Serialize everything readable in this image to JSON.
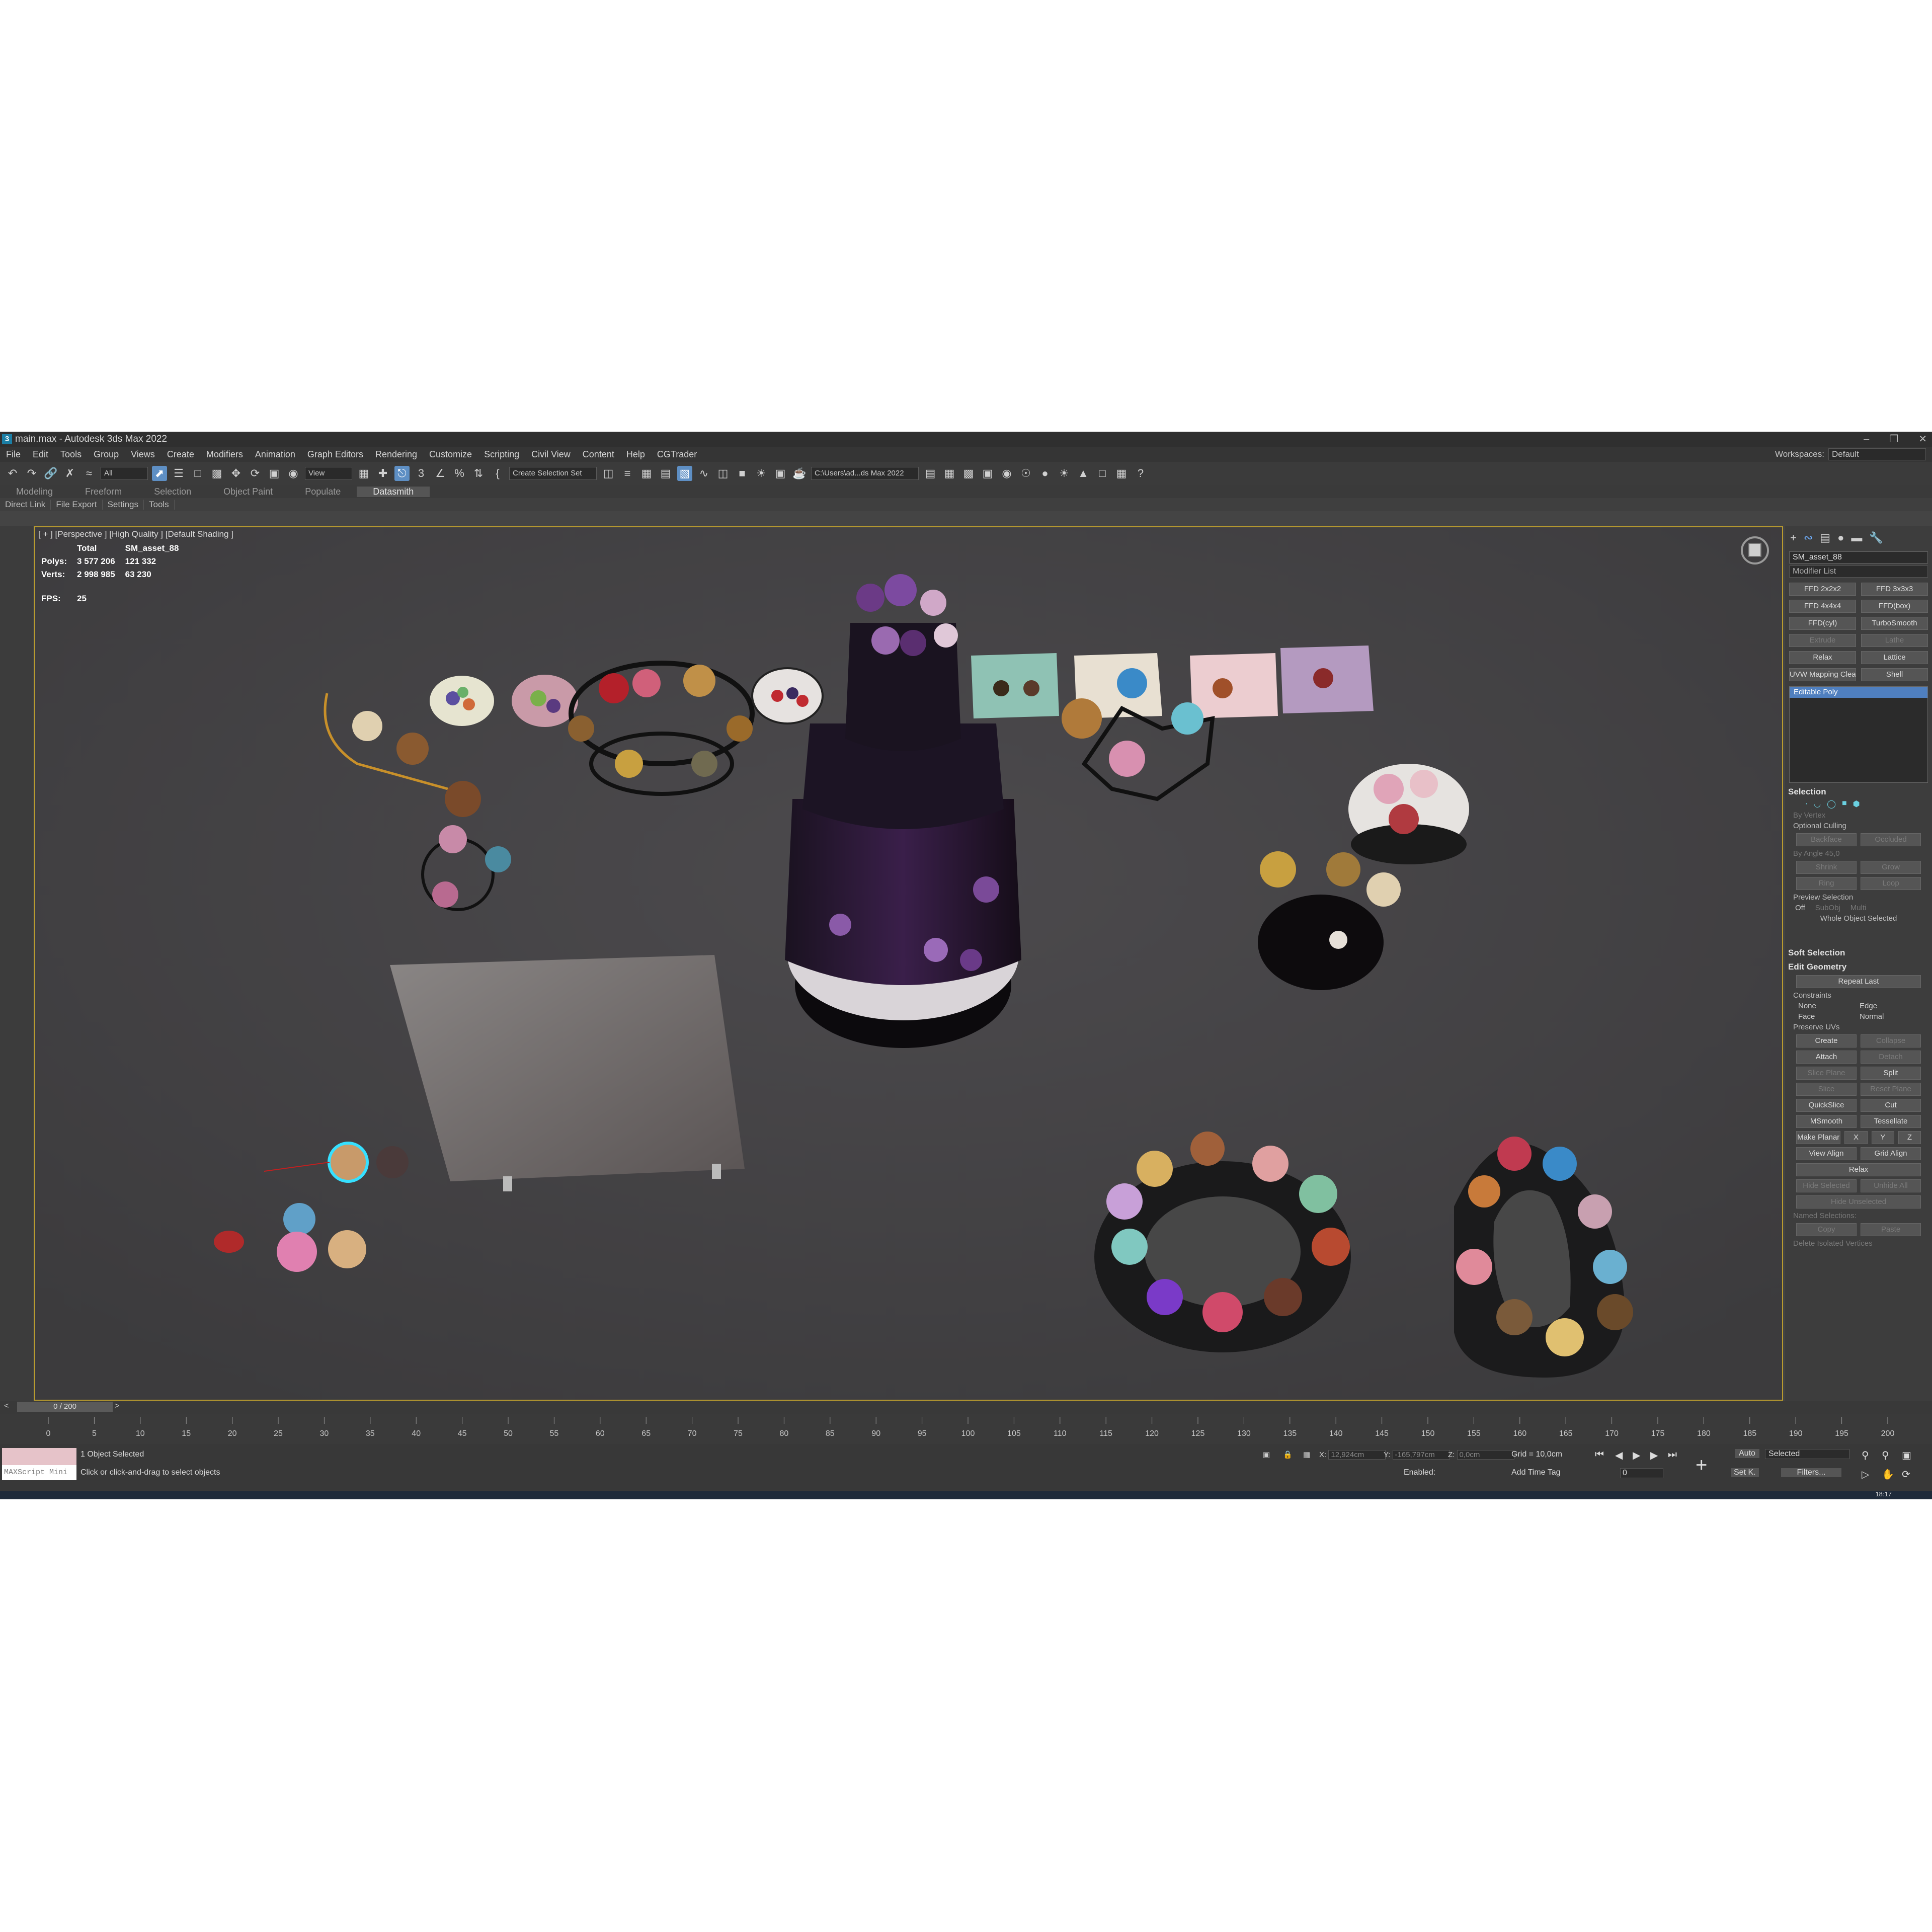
{
  "window": {
    "title": "main.max - Autodesk 3ds Max 2022",
    "app_icon": "3"
  },
  "menu": [
    "File",
    "Edit",
    "Tools",
    "Group",
    "Views",
    "Create",
    "Modifiers",
    "Animation",
    "Graph Editors",
    "Rendering",
    "Customize",
    "Scripting",
    "Civil View",
    "Content",
    "Help",
    "CGTrader"
  ],
  "workspaces": {
    "label": "Workspaces:",
    "value": "Default"
  },
  "toolbar": {
    "filter": "All",
    "refcoord": "View",
    "selection_set": "Create Selection Set",
    "path": "C:\\Users\\ad...ds Max 2022"
  },
  "ribbon_tabs": [
    "Modeling",
    "Freeform",
    "Selection",
    "Object Paint",
    "Populate",
    "Datasmith"
  ],
  "subbar": [
    "Direct Link",
    "File Export",
    "Settings",
    "Tools"
  ],
  "viewport": {
    "label": "[ + ] [Perspective ] [High Quality ] [Default Shading ]",
    "stats": {
      "col_total": "Total",
      "col_obj": "SM_asset_88",
      "polys_label": "Polys:",
      "polys_total": "3 577 206",
      "polys_obj": "121 332",
      "verts_label": "Verts:",
      "verts_total": "2 998 985",
      "verts_obj": "63 230",
      "fps_label": "FPS:",
      "fps": "25"
    }
  },
  "command_panel": {
    "object_name": "SM_asset_88",
    "modifier_list": "Modifier List",
    "modifier_buttons": [
      "FFD 2x2x2",
      "FFD 3x3x3",
      "FFD 4x4x4",
      "FFD(box)",
      "FFD(cyl)",
      "TurboSmooth",
      "Extrude",
      "Lathe",
      "Relax",
      "Lattice",
      "UVW Mapping Clea",
      "Shell"
    ],
    "stack_item": "Editable Poly",
    "selection": {
      "title": "Selection",
      "by_vertex": "By Vertex",
      "optional_culling": "Optional Culling",
      "backface": "Backface",
      "occluded": "Occluded",
      "by_angle": "By Angle",
      "angle_value": "45,0",
      "shrink": "Shrink",
      "grow": "Grow",
      "ring": "Ring",
      "loop": "Loop",
      "preview_selection": "Preview Selection",
      "off": "Off",
      "subobj": "SubObj",
      "multi": "Multi",
      "status": "Whole Object Selected"
    },
    "soft_selection": "Soft Selection",
    "edit_geometry": {
      "title": "Edit Geometry",
      "repeat_last": "Repeat Last",
      "constraints": "Constraints",
      "none": "None",
      "edge": "Edge",
      "face": "Face",
      "normal": "Normal",
      "preserve_uvs": "Preserve UVs",
      "create": "Create",
      "collapse": "Collapse",
      "attach": "Attach",
      "detach": "Detach",
      "slice_plane": "Slice Plane",
      "split": "Split",
      "slice": "Slice",
      "reset_plane": "Reset Plane",
      "quickslice": "QuickSlice",
      "cut": "Cut",
      "msmooth": "MSmooth",
      "tessellate": "Tessellate",
      "make_planar": "Make Planar",
      "x": "X",
      "y": "Y",
      "z": "Z",
      "view_align": "View Align",
      "grid_align": "Grid Align",
      "relax": "Relax",
      "hide_selected": "Hide Selected",
      "unhide_all": "Unhide All",
      "hide_unselected": "Hide Unselected",
      "named_selections": "Named Selections:",
      "copy": "Copy",
      "paste": "Paste",
      "delete_isolated": "Delete Isolated Vertices"
    }
  },
  "timeline": {
    "slider": "0 / 200",
    "ticks": [
      0,
      5,
      10,
      15,
      20,
      25,
      30,
      35,
      40,
      45,
      50,
      55,
      60,
      65,
      70,
      75,
      80,
      85,
      90,
      95,
      100,
      105,
      110,
      115,
      120,
      125,
      130,
      135,
      140,
      145,
      150,
      155,
      160,
      165,
      170,
      175,
      180,
      185,
      190,
      195,
      200
    ]
  },
  "status": {
    "maxscript": "MAXScript Mini",
    "selected": "1 Object Selected",
    "prompt": "Click or click-and-drag to select objects",
    "x_label": "X:",
    "x": "12,924cm",
    "y_label": "Y:",
    "y": "-165,797cm",
    "z_label": "Z:",
    "z": "0,0cm",
    "grid": "Grid = 10,0cm",
    "enabled": "Enabled:",
    "add_time_tag": "Add Time Tag",
    "auto": "Auto",
    "selected_dd": "Selected",
    "set_key": "Set K.",
    "filters": "Filters...",
    "frame": "0"
  },
  "taskbar": {
    "time": "18:17"
  },
  "colors": {
    "viewport_border": "#b89b2f",
    "selection_blue": "#5e8fc4",
    "stack_highlight": "#4f7fbf"
  }
}
